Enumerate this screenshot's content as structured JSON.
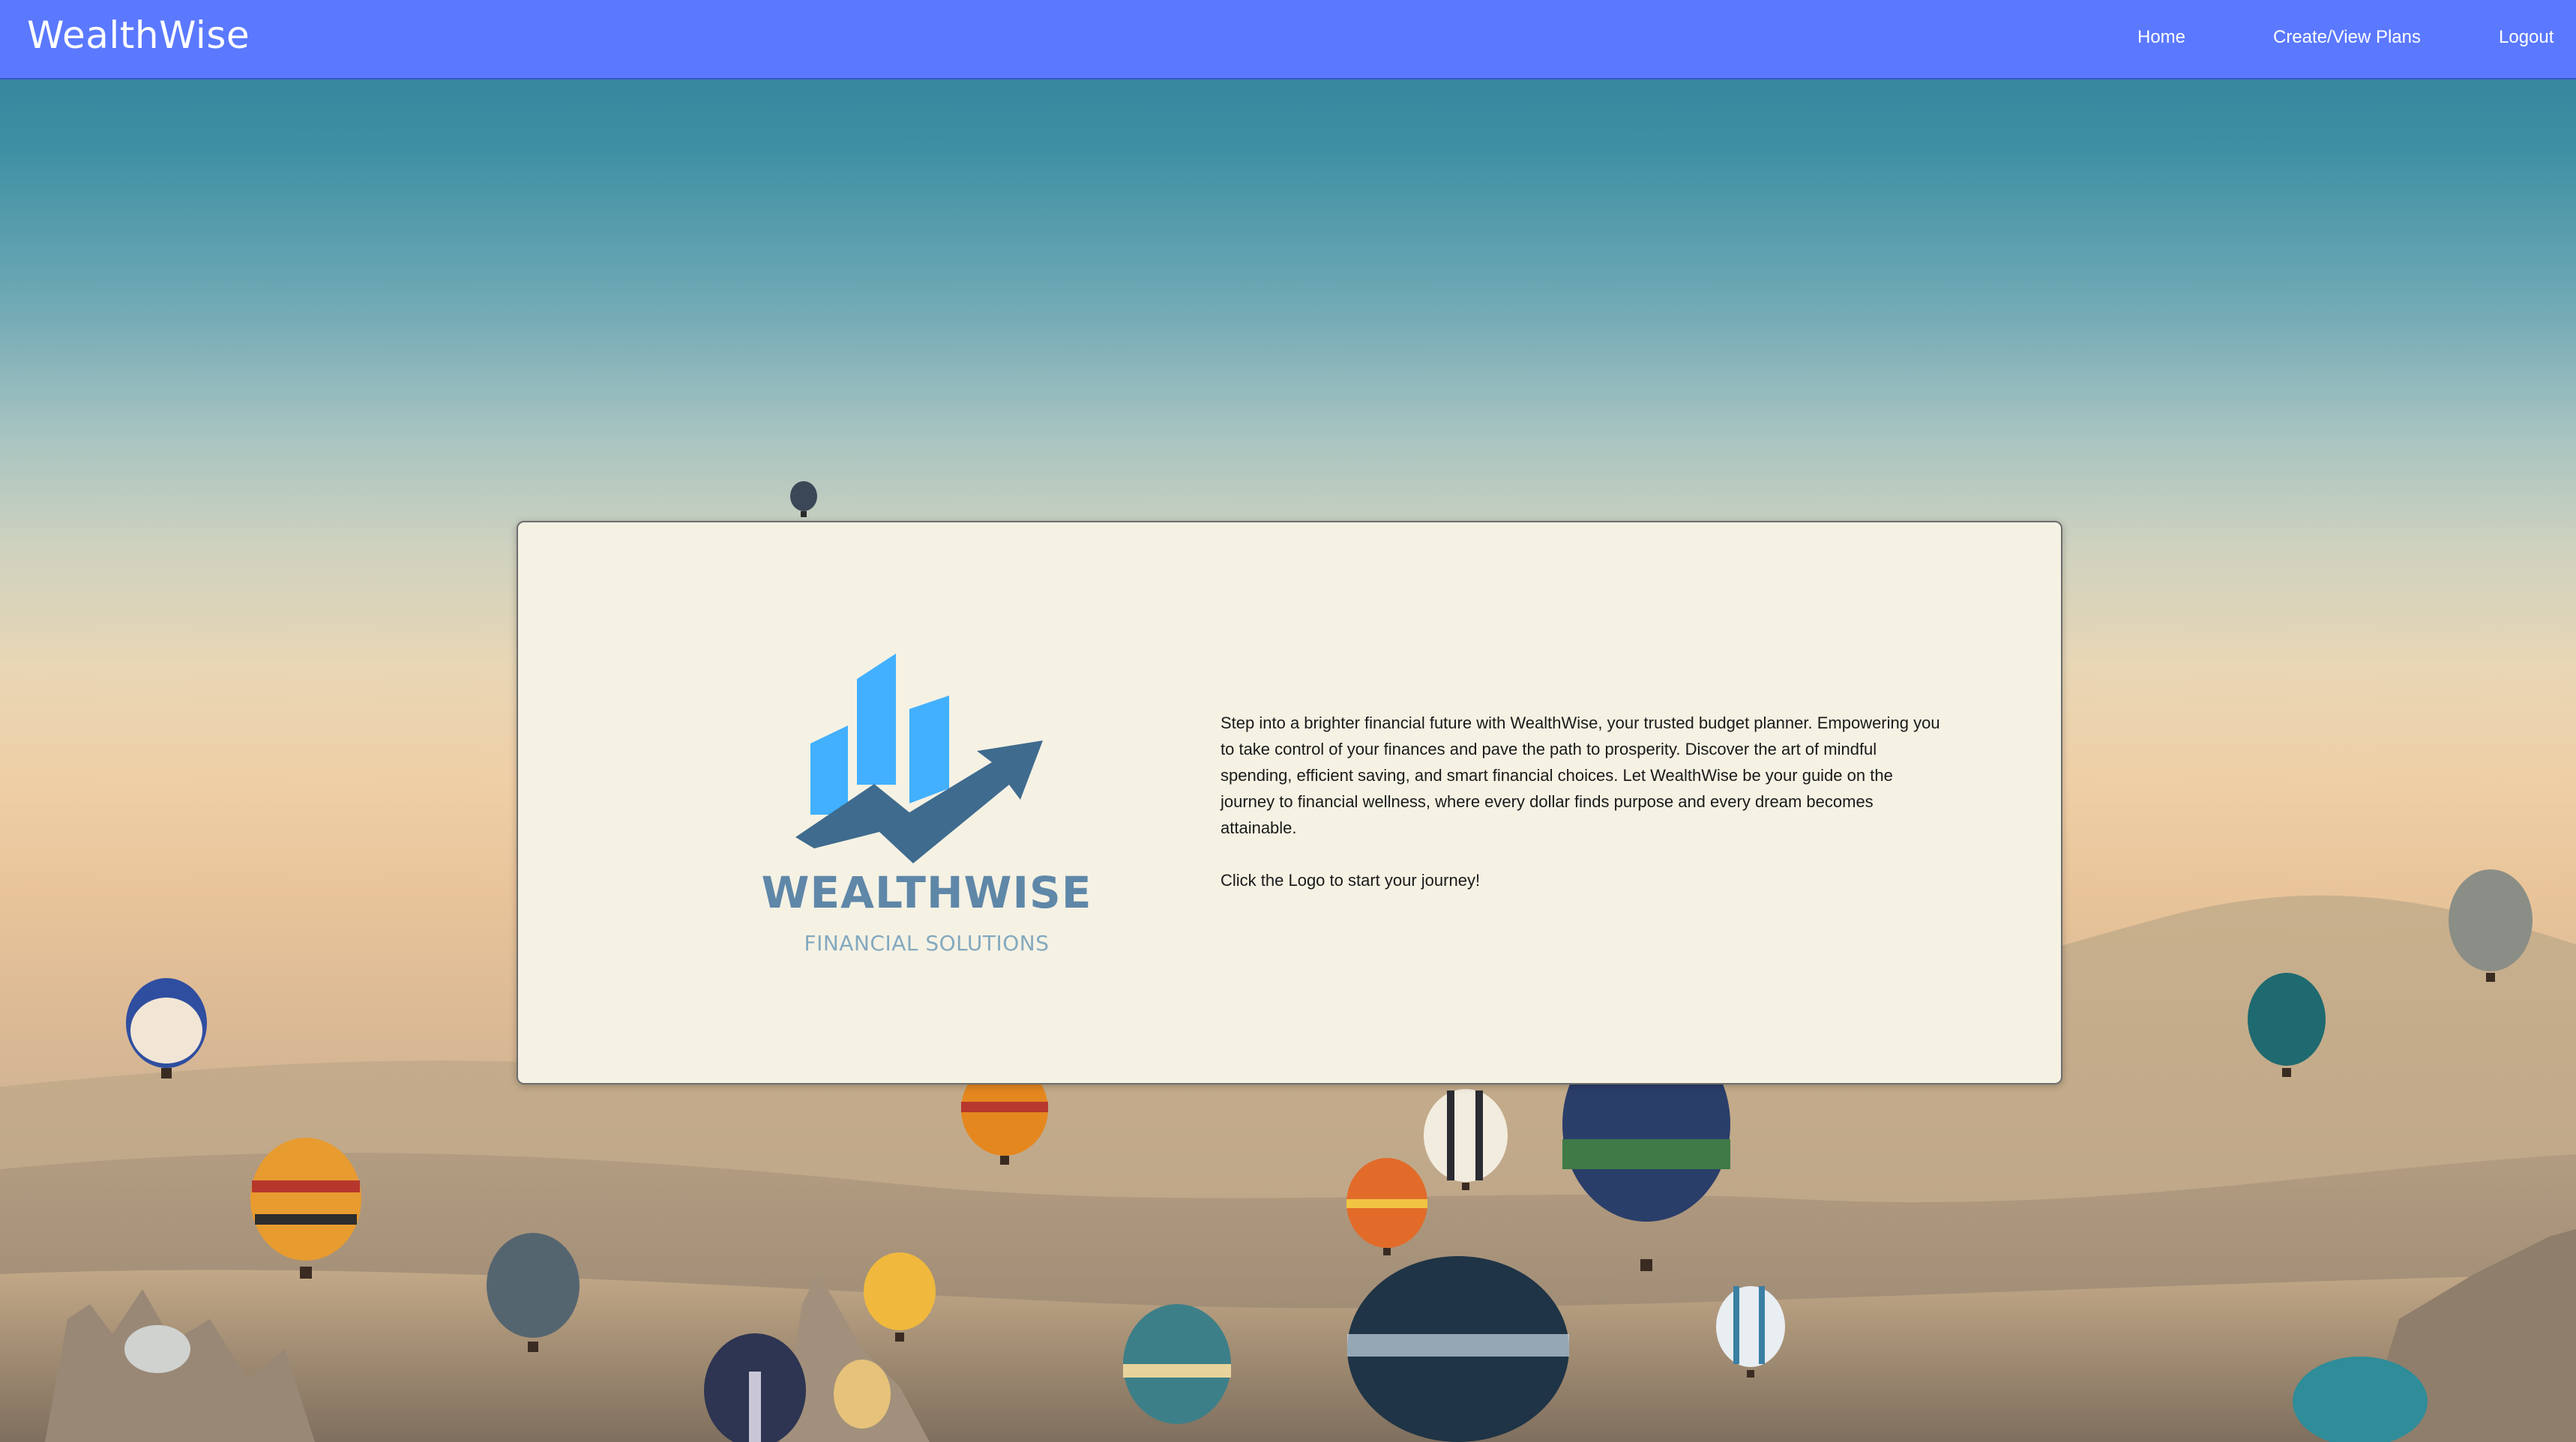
{
  "app": {
    "brand": "WealthWise"
  },
  "nav": {
    "links": [
      {
        "label": "Home"
      },
      {
        "label": "Create/View Plans"
      },
      {
        "label": "Logout"
      }
    ]
  },
  "card": {
    "logo": {
      "wordmark": "WEALTHWISE",
      "tagline": "FINANCIAL SOLUTIONS",
      "colors": {
        "bars": "#42b0ff",
        "arrow": "#3f6b8e",
        "wordmark": "#5f87a8"
      }
    },
    "description": "Step into a brighter financial future with WealthWise, your trusted budget planner. Empowering you to take control of your finances and pave the path to prosperity. Discover the art of mindful spending, efficient saving, and smart financial choices. Let WealthWise be your guide on the journey to financial wellness, where every dollar finds purpose and every dream becomes attainable.",
    "call_to_action": "Click the Logo to start your journey!"
  },
  "theme": {
    "navbar_color": "#5b79ff",
    "card_background": "#f5f2e4"
  }
}
